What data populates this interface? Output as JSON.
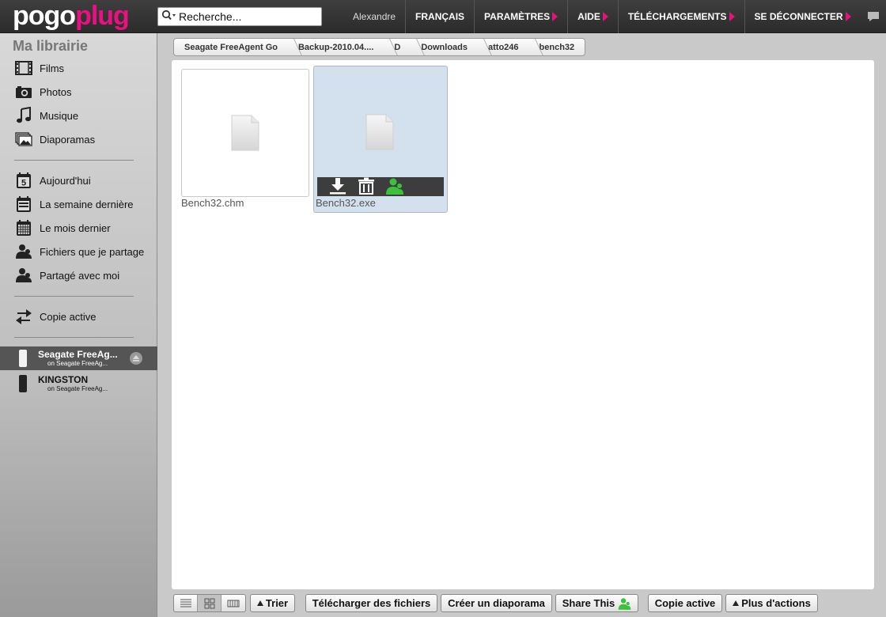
{
  "header": {
    "logo_part1": "pogo",
    "logo_part2": "plug",
    "search_placeholder": "Recherche...",
    "user": "Alexandre",
    "nav": [
      {
        "label": "FRANÇAIS",
        "has_arrow": false
      },
      {
        "label": "PARAMÈTRES",
        "has_arrow": true
      },
      {
        "label": "AIDE",
        "has_arrow": true
      },
      {
        "label": "TÉLÉCHARGEMENTS",
        "has_arrow": true
      },
      {
        "label": "SE DÉCONNECTER",
        "has_arrow": true
      }
    ],
    "accent_color": "#e8117f"
  },
  "sidebar": {
    "title": "Ma librairie",
    "media": [
      {
        "label": "Films",
        "icon": "film-icon"
      },
      {
        "label": "Photos",
        "icon": "camera-icon"
      },
      {
        "label": "Musique",
        "icon": "music-note-icon"
      },
      {
        "label": "Diaporamas",
        "icon": "slideshow-icon"
      }
    ],
    "time": [
      {
        "label": "Aujourd'hui",
        "icon": "calendar-day-icon",
        "day": "5"
      },
      {
        "label": "La semaine dernière",
        "icon": "calendar-week-icon"
      },
      {
        "label": "Le mois dernier",
        "icon": "calendar-month-icon"
      },
      {
        "label": "Fichiers que je partage",
        "icon": "shared-user-icon"
      },
      {
        "label": "Partagé avec moi",
        "icon": "shared-with-me-icon"
      }
    ],
    "sync": {
      "label": "Copie active",
      "icon": "sync-arrows-icon"
    },
    "devices": [
      {
        "name": "Seagate FreeAg...",
        "sub": "on Seagate FreeAg...",
        "active": true,
        "color": "#f2f2f2"
      },
      {
        "name": "KINGSTON",
        "sub": "on Seagate FreeAg...",
        "active": false,
        "color": "#222222"
      }
    ]
  },
  "breadcrumb": [
    "Seagate FreeAgent Go",
    "Backup-2010.04....",
    "D",
    "Downloads",
    "atto246",
    "bench32"
  ],
  "files": [
    {
      "name": "Bench32.chm",
      "selected": false
    },
    {
      "name": "Bench32.exe",
      "selected": true
    }
  ],
  "toolbar": {
    "sort_label": "Trier",
    "download_label": "Télécharger des fichiers",
    "slideshow_label": "Créer un diaporama",
    "share_label": "Share This",
    "sync_label": "Copie active",
    "more_label": "Plus d'actions"
  }
}
